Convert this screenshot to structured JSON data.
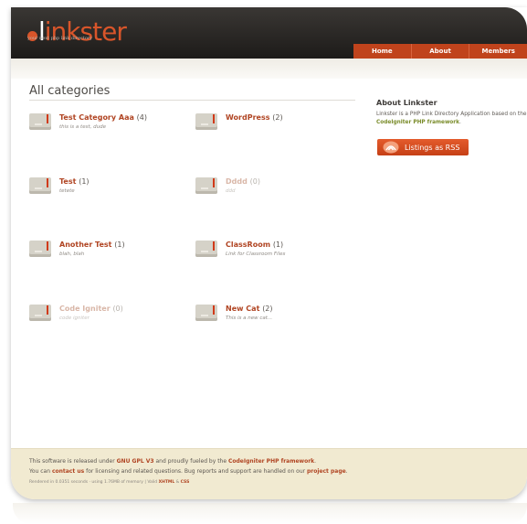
{
  "logo": {
    "text_a": "l",
    "text_b": "inkster",
    "tagline": "your next php link directory"
  },
  "nav": [
    {
      "label": "Home",
      "name": "nav-home"
    },
    {
      "label": "About",
      "name": "nav-about"
    },
    {
      "label": "Members",
      "name": "nav-members"
    }
  ],
  "main": {
    "title": "All categories",
    "categories": [
      {
        "name": "Test Category Aaa",
        "count": "(4)",
        "desc": "this is a test, dude"
      },
      {
        "name": "WordPress",
        "count": "(2)",
        "desc": ""
      },
      {
        "name": "Test",
        "count": "(1)",
        "desc": "tetete"
      },
      {
        "name": "Dddd",
        "count": "(0)",
        "desc": "ddd"
      },
      {
        "name": "Another Test",
        "count": "(1)",
        "desc": "blah, blah"
      },
      {
        "name": "ClassRoom",
        "count": "(1)",
        "desc": "Link for Classroom Files"
      },
      {
        "name": "Code Igniter",
        "count": "(0)",
        "desc": "code igniter"
      },
      {
        "name": "New Cat",
        "count": "(2)",
        "desc": "This is a new cat..."
      }
    ]
  },
  "sidebar": {
    "title": "About Linkster",
    "text_a": "Linkster is a PHP Link Directory Application based on the ",
    "text_link": "CodeIgniter PHP framework",
    "text_b": ".",
    "rss_label": "Listings as RSS"
  },
  "footer": {
    "l1_a": "This software is released under ",
    "l1_b": "GNU GPL V3",
    "l1_c": " and proudly fueled by the ",
    "l1_d": "CodeIgniter PHP framework",
    "l1_e": ".",
    "l2_a": "You can ",
    "l2_b": "contact us",
    "l2_c": " for licensing and related questions. Bug reports and support are handled on our ",
    "l2_d": "project page",
    "l2_e": ".",
    "l3_a": "Rendered in 0.0351 seconds · using 1.76MB of memory | Valid ",
    "l3_b": "XHTML",
    "l3_c": " & ",
    "l3_d": "CSS"
  },
  "colors": {
    "accent": "#c0431c",
    "header_bg": "#2a2826",
    "footer_bg": "#f1ead1"
  }
}
